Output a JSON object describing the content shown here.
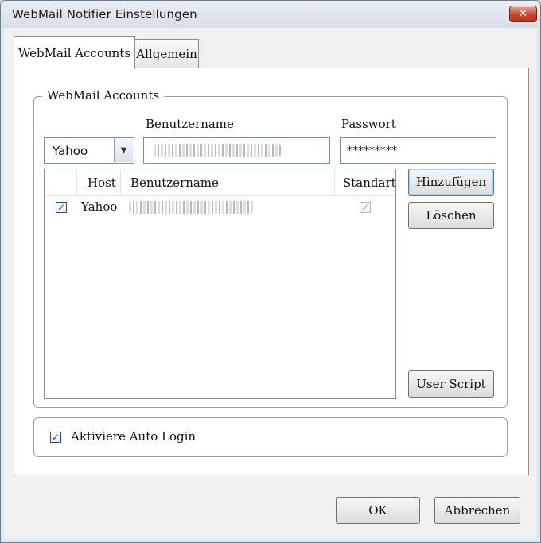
{
  "window": {
    "title": "WebMail Notifier Einstellungen",
    "close_symbol": "✕"
  },
  "tabs": [
    {
      "label": "WebMail Accounts",
      "active": true
    },
    {
      "label": "Allgemein",
      "active": false
    }
  ],
  "accounts_group": {
    "legend": "WebMail Accounts",
    "host_select": {
      "value": "Yahoo"
    },
    "username_label": "Benutzername",
    "username_value": "",
    "password_label": "Passwort",
    "password_value": "*********",
    "list": {
      "columns": [
        "",
        "Host",
        "Benutzername",
        "Standart"
      ],
      "rows": [
        {
          "checked": true,
          "host": "Yahoo",
          "username": "",
          "default_checked": true
        }
      ]
    },
    "buttons": {
      "add": "Hinzufügen",
      "delete": "Löschen",
      "user_script": "User Script"
    }
  },
  "auto_login": {
    "label": "Aktiviere Auto Login",
    "checked": true
  },
  "dialog_buttons": {
    "ok": "OK",
    "cancel": "Abbrechen"
  },
  "icons": {
    "dropdown": "chevron-down-icon",
    "close": "close-icon",
    "check": "check-icon"
  },
  "colors": {
    "close_button": "#c9452c",
    "focus_border": "#3c7fb1",
    "checkbox_border": "#1c5180"
  }
}
